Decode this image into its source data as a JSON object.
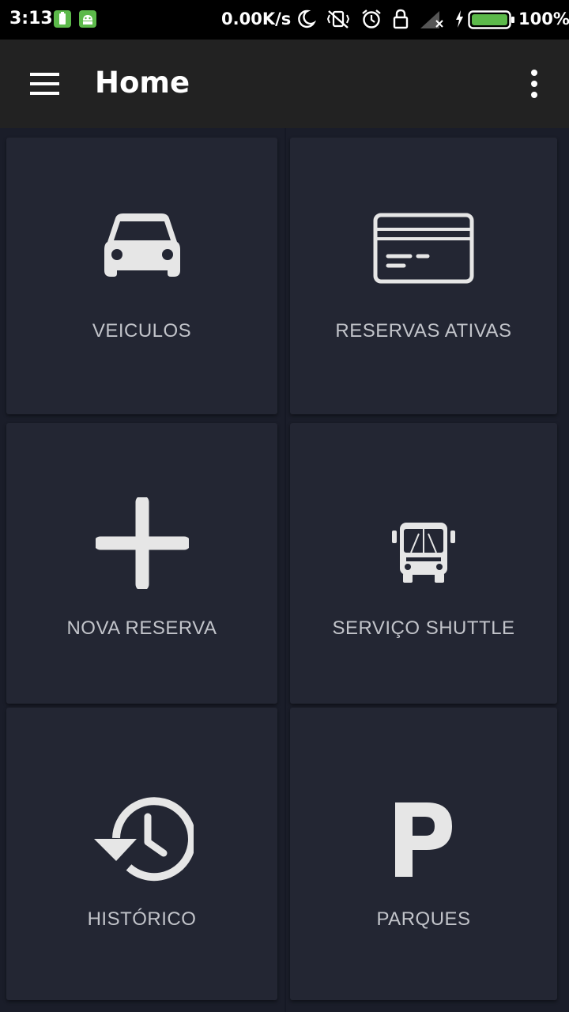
{
  "status_bar": {
    "time": "3:13",
    "network_speed": "0.00K/s",
    "battery": "100%",
    "icons": [
      "battery-notification-icon",
      "android-notification-icon",
      "moon-icon",
      "vibrate-off-icon",
      "alarm-icon",
      "lock-icon",
      "signal-icon",
      "charging-icon",
      "battery-icon"
    ],
    "battery_color": "#5cb94a"
  },
  "app_bar": {
    "title": "Home",
    "menu_icon": "hamburger-menu-icon",
    "overflow_icon": "more-vertical-icon",
    "background": "#222222"
  },
  "tiles": [
    {
      "label": "VEICULOS",
      "icon": "car-icon"
    },
    {
      "label": "RESERVAS ATIVAS",
      "icon": "credit-card-icon"
    },
    {
      "label": "NOVA RESERVA",
      "icon": "plus-icon"
    },
    {
      "label": "SERVIÇO SHUTTLE",
      "icon": "bus-icon"
    },
    {
      "label": "HISTÓRICO",
      "icon": "history-icon"
    },
    {
      "label": "PARQUES",
      "icon": "parking-icon"
    }
  ],
  "colors": {
    "tile_background": "#232633",
    "page_background": "#1a1d29",
    "label_text": "#c2c4ca",
    "icon": "#e6e6e6"
  }
}
